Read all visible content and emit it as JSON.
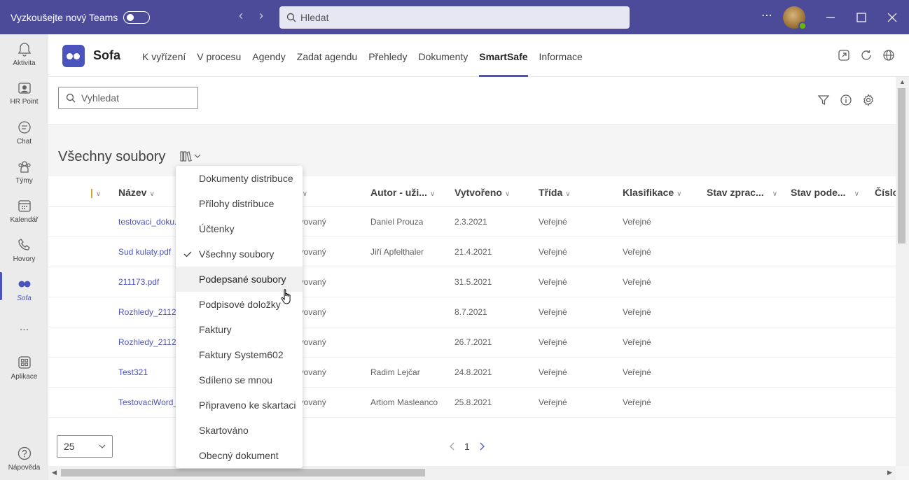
{
  "titlebar": {
    "try_new": "Vyzkoušejte nový Teams",
    "search_placeholder": "Hledat"
  },
  "rail": {
    "items": [
      {
        "label": "Aktivita",
        "icon": "bell-icon"
      },
      {
        "label": "HR Point",
        "icon": "hr-point-icon"
      },
      {
        "label": "Chat",
        "icon": "chat-icon"
      },
      {
        "label": "Týmy",
        "icon": "teams-icon"
      },
      {
        "label": "Kalendář",
        "icon": "calendar-icon"
      },
      {
        "label": "Hovory",
        "icon": "phone-icon"
      },
      {
        "label": "Sofa",
        "icon": "sofa-icon"
      },
      {
        "label": "Aplikace",
        "icon": "apps-icon"
      },
      {
        "label": "Nápověda",
        "icon": "help-icon"
      }
    ],
    "more": "..."
  },
  "app": {
    "name": "Sofa",
    "tabs": [
      "K vyřízení",
      "V procesu",
      "Agendy",
      "Zadat agendu",
      "Přehledy",
      "Dokumenty",
      "SmartSafe",
      "Informace"
    ],
    "active_tab": "SmartSafe"
  },
  "toolbar": {
    "search_placeholder": "Vyhledat"
  },
  "section": {
    "title": "Všechny soubory"
  },
  "grid": {
    "columns": [
      "Název",
      "v",
      "Autor - uži...",
      "Vytvořeno",
      "Třída",
      "Klasifikace",
      "Stav zprac...",
      "Stav pode...",
      "Číslo"
    ],
    "rows": [
      {
        "name": "testovaci_doku...",
        "state": "ivovaný",
        "author": "Daniel Prouza",
        "created": "2.3.2021",
        "class": "Veřejné",
        "classification": "Veřejné"
      },
      {
        "name": "Sud kulaty.pdf",
        "state": "ivovaný",
        "author": "Jiří Apfelthaler",
        "created": "21.4.2021",
        "class": "Veřejné",
        "classification": "Veřejné"
      },
      {
        "name": "211173.pdf",
        "state": "ivovaný",
        "author": "",
        "created": "31.5.2021",
        "class": "Veřejné",
        "classification": "Veřejné"
      },
      {
        "name": "Rozhledy_2112...",
        "state": "ivovaný",
        "author": "",
        "created": "8.7.2021",
        "class": "Veřejné",
        "classification": "Veřejné"
      },
      {
        "name": "Rozhledy_2112...",
        "state": "ivovaný",
        "author": "",
        "created": "26.7.2021",
        "class": "Veřejné",
        "classification": "Veřejné"
      },
      {
        "name": "Test321",
        "state": "ivovaný",
        "author": "Radim Lejčar",
        "created": "24.8.2021",
        "class": "Veřejné",
        "classification": "Veřejné"
      },
      {
        "name": "TestovaciWord_...",
        "state": "ivovaný",
        "author": "Artiom Masleanco",
        "created": "25.8.2021",
        "class": "Veřejné",
        "classification": "Veřejné"
      }
    ]
  },
  "footer": {
    "page_size": "25",
    "current_page": "1"
  },
  "menu": {
    "items": [
      "Dokumenty distribuce",
      "Přílohy distribuce",
      "Účtenky",
      "Všechny soubory",
      "Podepsané soubory",
      "Podpisové doložky",
      "Faktury",
      "Faktury System602",
      "Sdíleno se mnou",
      "Připraveno ke skartaci",
      "Skartováno",
      "Obecný dokument"
    ],
    "checked": "Všechny soubory",
    "hovered": "Podepsané soubory"
  },
  "colors": {
    "titlebar": "#4b4b9a",
    "accent": "#4b53bc",
    "link": "#4b53bc"
  }
}
